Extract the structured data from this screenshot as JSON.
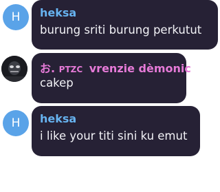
{
  "colors": {
    "chat_bg": "#ffffff",
    "bubble_bg": "#262135",
    "name_blue": "#67b3f0",
    "name_pink": "#e57ad7",
    "avatar_blue": "#5aa3e8",
    "message_text": "#f2f2f6"
  },
  "messages": [
    {
      "avatar": {
        "type": "letter",
        "letter": "H"
      },
      "sender": "heksa",
      "text": "burung sriti burung perkutut"
    },
    {
      "avatar": {
        "type": "photo",
        "icon": "user-photo"
      },
      "sender_prefix": "お.",
      "sender_tag": "PTZC",
      "sender": "vrenzie dèmonic",
      "text": "cakep"
    },
    {
      "avatar": {
        "type": "letter",
        "letter": "H"
      },
      "sender": "heksa",
      "text": "i like your titi sini ku emut"
    }
  ]
}
